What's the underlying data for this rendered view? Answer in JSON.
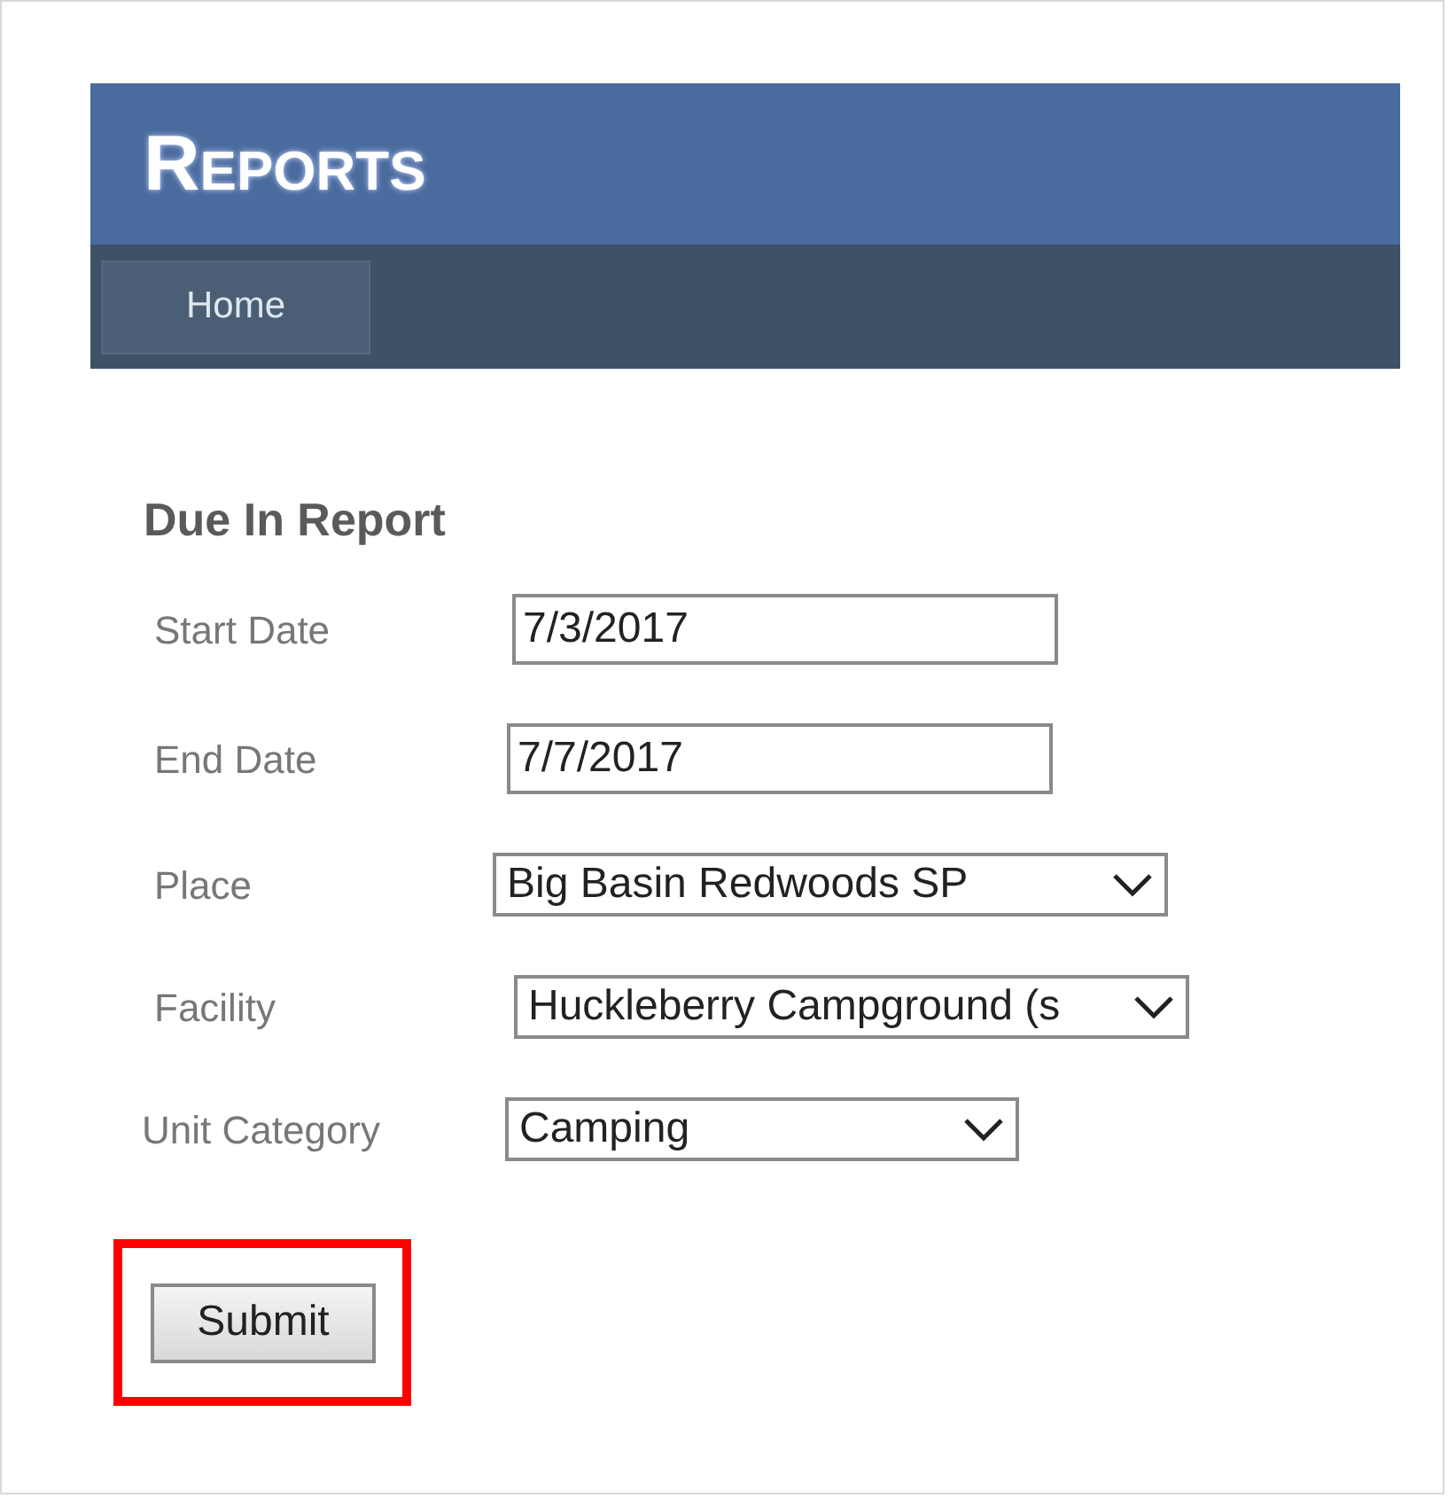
{
  "header": {
    "title": "Reports"
  },
  "nav": [
    {
      "label": "Home",
      "selected": true
    }
  ],
  "form": {
    "title": "Due In Report",
    "fields": [
      {
        "label": "Start Date",
        "kind": "text",
        "value": "7/3/2017"
      },
      {
        "label": "End Date",
        "kind": "text",
        "value": "7/7/2017"
      },
      {
        "label": "Place",
        "kind": "select",
        "value": "Big Basin Redwoods SP"
      },
      {
        "label": "Facility",
        "kind": "select",
        "value": "Huckleberry Campground (s"
      },
      {
        "label": "Unit Category",
        "kind": "select",
        "value": "Camping"
      }
    ],
    "submit": {
      "label": "Submit",
      "highlighted": true
    }
  }
}
